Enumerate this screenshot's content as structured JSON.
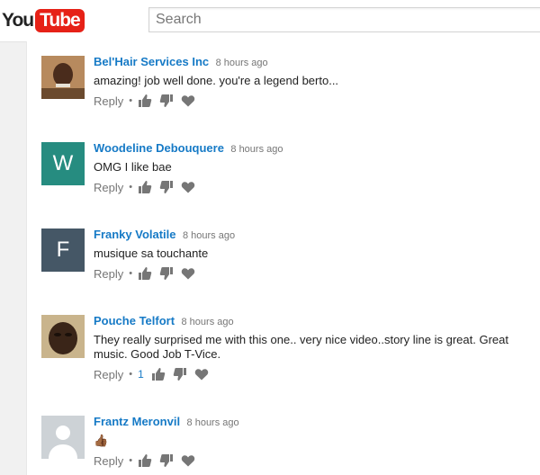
{
  "header": {
    "logo_you": "You",
    "logo_tube": "Tube",
    "search_placeholder": "Search"
  },
  "colors": {
    "brand_red": "#e62117",
    "link_blue": "#167ac6",
    "meta_gray": "#767676"
  },
  "comments": [
    {
      "author": "Bel'Hair Services Inc",
      "time": "8 hours ago",
      "text": "amazing! job well done. you're a legend berto...",
      "reply_label": "Reply",
      "likes": ""
    },
    {
      "author": "Woodeline Debouquere",
      "time": "8 hours ago",
      "text": "OMG I like bae",
      "reply_label": "Reply",
      "likes": "",
      "avatar_letter": "W",
      "avatar_color": "#268c80"
    },
    {
      "author": "Franky Volatile",
      "time": "8 hours ago",
      "text": "musique sa touchante",
      "reply_label": "Reply",
      "likes": "",
      "avatar_letter": "F",
      "avatar_color": "#455766"
    },
    {
      "author": "Pouche Telfort",
      "time": "8 hours ago",
      "text": "They really surprised me with this one.. very nice video..story line is great. Great music. Good Job T-Vice.",
      "reply_label": "Reply",
      "likes": "1"
    },
    {
      "author": "Frantz Meronvil",
      "time": "8 hours ago",
      "text": "👍🏾",
      "reply_label": "Reply",
      "likes": ""
    }
  ]
}
